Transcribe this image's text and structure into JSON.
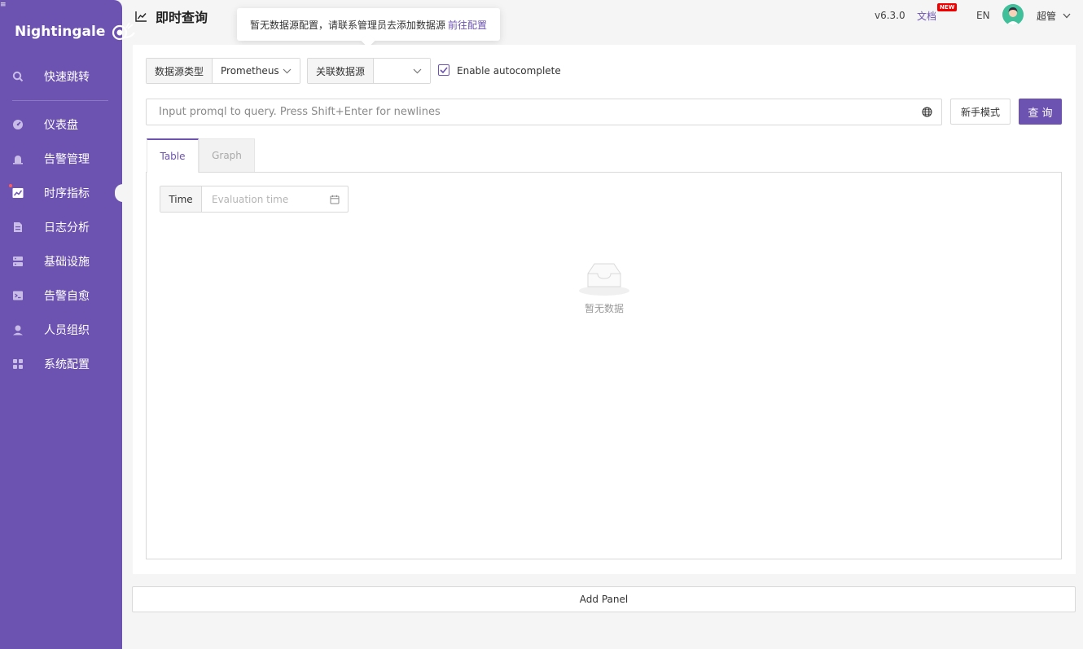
{
  "sidebar": {
    "brand": "Nightingale",
    "brand_icon": "snail-logo-icon",
    "items": [
      {
        "label": "快速跳转",
        "icon": "search-icon"
      },
      {
        "label": "仪表盘",
        "icon": "dashboard-icon"
      },
      {
        "label": "告警管理",
        "icon": "alarm-icon"
      },
      {
        "label": "时序指标",
        "icon": "line-chart-icon",
        "active": true
      },
      {
        "label": "日志分析",
        "icon": "document-icon"
      },
      {
        "label": "基础设施",
        "icon": "server-icon"
      },
      {
        "label": "告警自愈",
        "icon": "terminal-icon"
      },
      {
        "label": "人员组织",
        "icon": "user-icon"
      },
      {
        "label": "系统配置",
        "icon": "apps-icon"
      }
    ]
  },
  "header": {
    "title": "即时查询",
    "version": "v6.3.0",
    "docs_label": "文档",
    "docs_badge": "NEW",
    "lang": "EN",
    "username": "超管"
  },
  "tooltip": {
    "message": "暂无数据源配置，请联系管理员去添加数据源",
    "link": "前往配置"
  },
  "query": {
    "datasource_type_label": "数据源类型",
    "datasource_type_value": "Prometheus",
    "datasource_label": "关联数据源",
    "datasource_value": "",
    "autocomplete_label": "Enable autocomplete",
    "autocomplete_checked": true,
    "input_placeholder": "Input promql to query. Press Shift+Enter for newlines",
    "input_value": "",
    "novice_button": "新手模式",
    "query_button": "查 询"
  },
  "tabs": [
    {
      "label": "Table",
      "active": true
    },
    {
      "label": "Graph",
      "active": false
    }
  ],
  "table_panel": {
    "time_label": "Time",
    "time_placeholder": "Evaluation time",
    "empty_text": "暂无数据"
  },
  "add_panel_label": "Add Panel",
  "colors": {
    "brand": "#6c53b1",
    "badge": "#ee0000",
    "page_bg": "#f5f5f5"
  }
}
